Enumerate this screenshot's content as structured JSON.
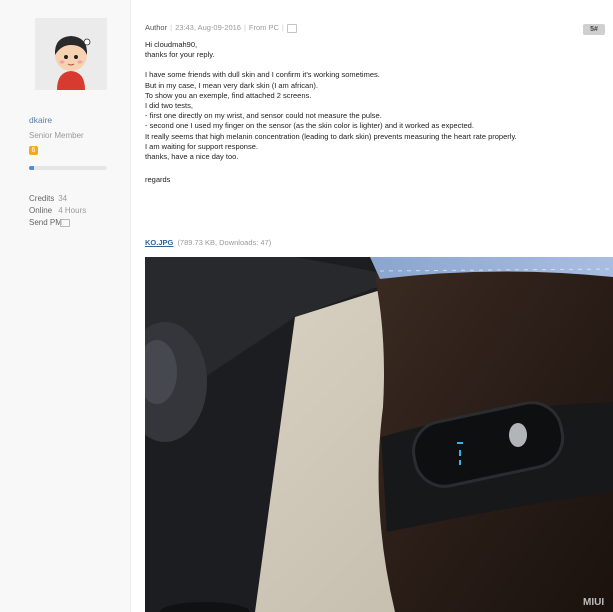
{
  "user": {
    "name": "dkaire",
    "group": "Senior Member",
    "level_icon": "level-badge-icon",
    "level_badge_text": "6",
    "progress_percent": 6,
    "stats": [
      {
        "label": "Credits",
        "value": "34"
      },
      {
        "label": "Online",
        "value": "4 Hours"
      },
      {
        "label": "Send PM",
        "value": ""
      }
    ]
  },
  "post": {
    "author_label": "Author",
    "time": "23:43, Aug-09-2016",
    "source": "From PC",
    "floor": "5#",
    "lines": [
      "Hi cloudmah90,",
      "thanks for your reply.",
      "",
      "I have some friends with dull skin and I confirm it's working sometimes.",
      "But in my case, I mean very dark skin (I am african).",
      "To show you an exemple, find attached 2 screens.",
      "I did two tests,",
      "- first one directly on my wrist, and sensor could not measure the pulse.",
      "- second one I used my finger on the sensor (as the skin color is lighter) and it worked as expected.",
      "It really seems that high melanin concentration (leading to dark skin) prevents measuring the heart rate properly.",
      "I am waiting for support response.",
      "thanks, have a nice  day too.",
      "",
      "regards"
    ],
    "attachment": {
      "filename": "KO.JPG",
      "info": "(789.73 KB, Downloads: 47)"
    },
    "photo_watermark": "MIUI"
  },
  "colors": {
    "link": "#336699",
    "level_badge": "#f5a623",
    "progress": "#4a90e2"
  }
}
